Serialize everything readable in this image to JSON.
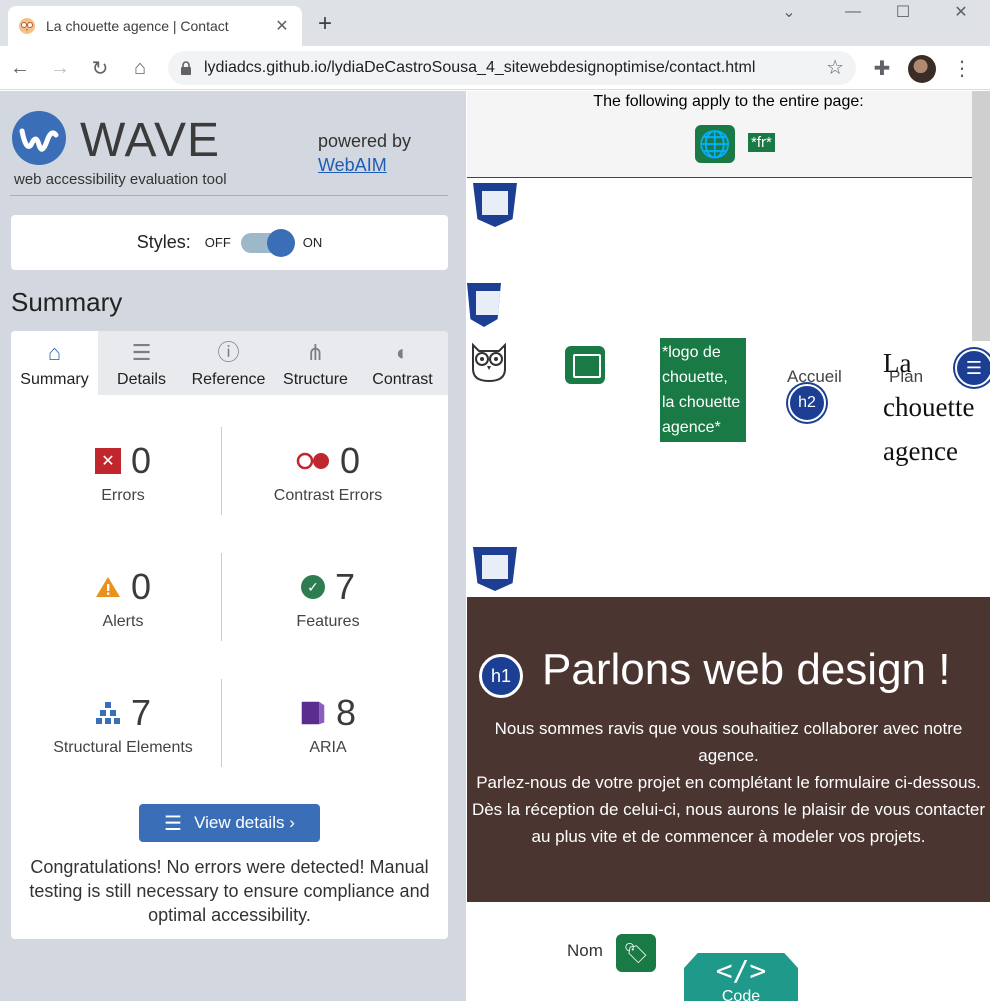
{
  "browser": {
    "tab_title": "La chouette agence | Contact",
    "url": "lydiadcs.github.io/lydiaDeCastroSousa_4_sitewebdesignoptimise/contact.html"
  },
  "wave": {
    "title": "WAVE",
    "subtitle": "web accessibility evaluation tool",
    "powered_by": "powered by",
    "webaim": "WebAIM",
    "styles_label": "Styles:",
    "styles_off": "OFF",
    "styles_on": "ON",
    "summary_heading": "Summary",
    "tabs": [
      {
        "label": "Summary",
        "icon": "home-icon"
      },
      {
        "label": "Details",
        "icon": "list-icon"
      },
      {
        "label": "Reference",
        "icon": "info-icon"
      },
      {
        "label": "Structure",
        "icon": "structure-icon"
      },
      {
        "label": "Contrast",
        "icon": "contrast-icon"
      }
    ],
    "stats": [
      {
        "label": "Errors",
        "value": "0",
        "icon": "error-icon",
        "color": "#c0262d"
      },
      {
        "label": "Contrast Errors",
        "value": "0",
        "icon": "contrast-error-icon",
        "color": "#c0262d"
      },
      {
        "label": "Alerts",
        "value": "0",
        "icon": "alert-icon",
        "color": "#e8911c"
      },
      {
        "label": "Features",
        "value": "7",
        "icon": "feature-icon",
        "color": "#2e7d52"
      },
      {
        "label": "Structural Elements",
        "value": "7",
        "icon": "structural-icon",
        "color": "#3a6fb8"
      },
      {
        "label": "ARIA",
        "value": "8",
        "icon": "aria-icon",
        "color": "#5b2d8e"
      }
    ],
    "view_details": "View details ›",
    "congrats": "Congratulations! No errors were detected! Manual testing is still necessary to ensure compliance and optimal accessibility."
  },
  "page": {
    "applies": "The following apply to the entire page:",
    "lang_badge": "*fr*",
    "logo_alt": "*logo de chouette, la chouette agence*",
    "nav_accueil": "Accueil",
    "nav_plan": "Plan",
    "h2_badge": "h2",
    "brand": "La chouette agence",
    "h1_badge": "h1",
    "hero_title": "Parlons web design !",
    "hero_lines": [
      "Nous sommes ravis que vous souhaitiez collaborer avec notre agence.",
      "Parlez-nous de votre projet en complétant le formulaire ci-dessous.",
      "Dès la réception de celui-ci, nous aurons le plaisir de vous contacter au plus vite et de commencer à modeler vos projets."
    ],
    "nom_label": "Nom",
    "code_label": "Code",
    "code_symbol": "</>"
  },
  "colors": {
    "wave_blue": "#3a6fb8",
    "feature_green": "#1a7a45",
    "hero_bg": "#4a3530",
    "landmark_blue": "#1c3f94"
  }
}
